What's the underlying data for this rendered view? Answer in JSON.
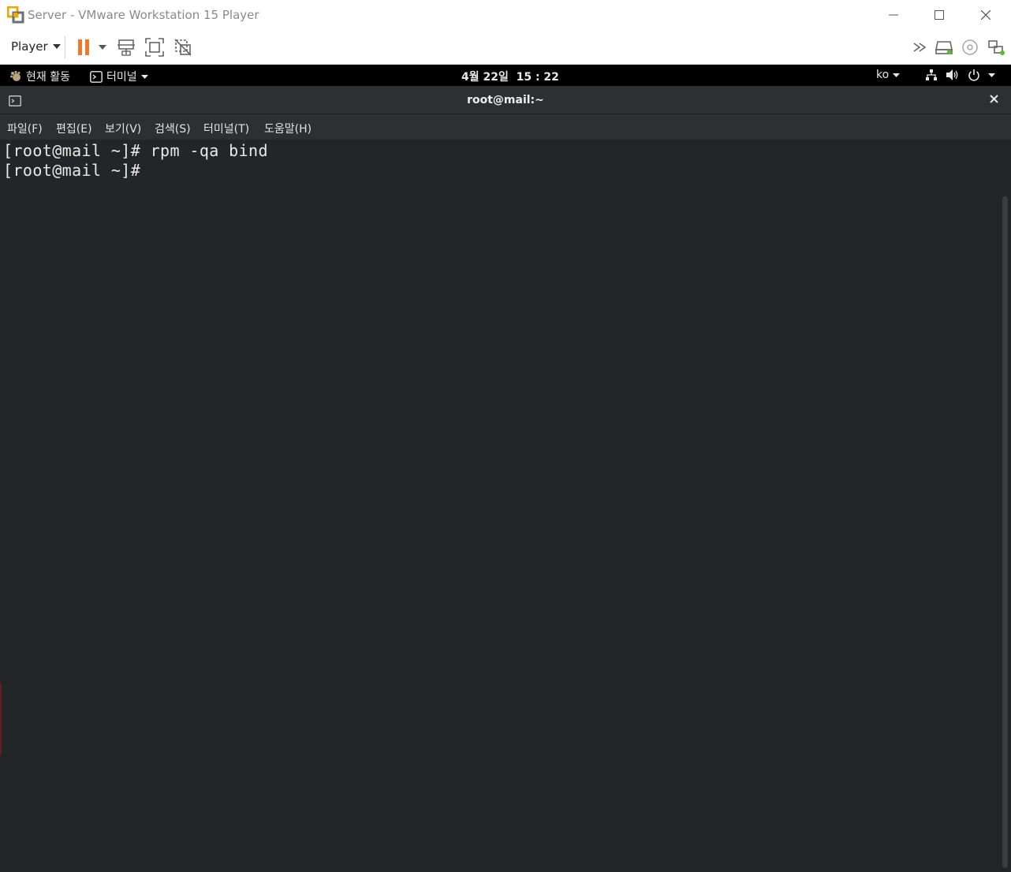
{
  "window": {
    "title": "Server - VMware Workstation 15 Player"
  },
  "toolbar": {
    "player_label": "Player",
    "icons": [
      "pause-icon",
      "send-ctrl-alt-del-icon",
      "fullscreen-icon",
      "unity-icon",
      "forward-icon",
      "hard-disk-icon",
      "cd-rom-icon",
      "network-adapter-icon"
    ],
    "accent_color": "#f0762b"
  },
  "gnome": {
    "activities": "현재 활동",
    "app_menu": "터미널",
    "clock": "4월 22일  15 : 22",
    "input_method": "ko"
  },
  "terminal": {
    "title": "root@mail:~",
    "menu": [
      "파일(F)",
      "편집(E)",
      "보기(V)",
      "검색(S)",
      "터미널(T)",
      "도움말(H)"
    ],
    "lines": [
      "[root@mail ~]# rpm -qa bind",
      "[root@mail ~]#"
    ],
    "background": "#232629"
  }
}
